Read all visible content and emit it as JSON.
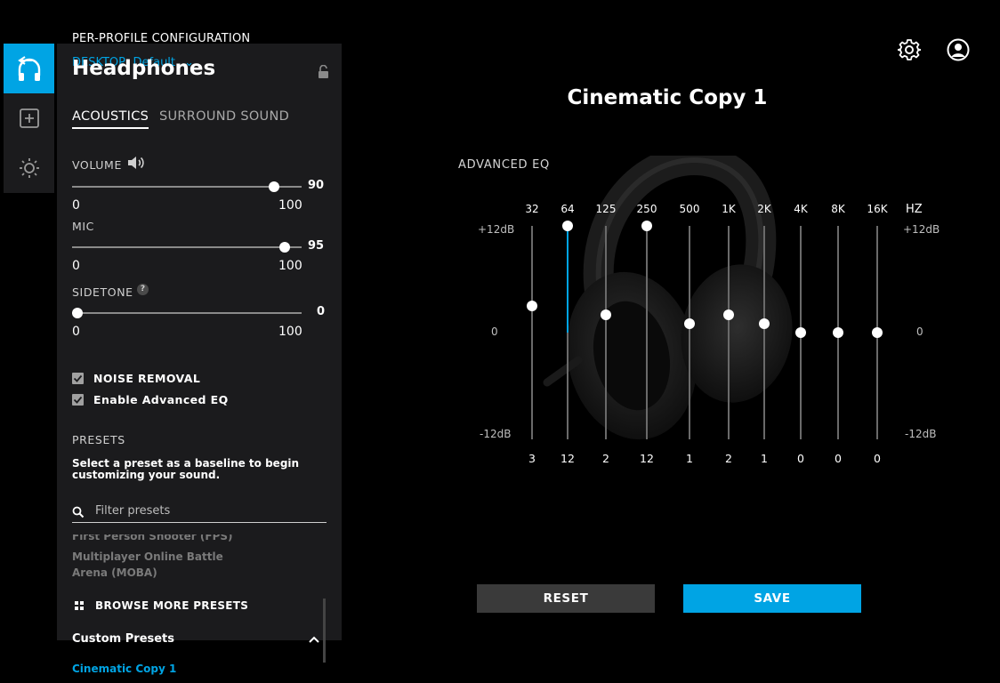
{
  "header": {
    "config_label": "PER-PROFILE CONFIGURATION",
    "profile_selector": "DESKTOP: Default"
  },
  "rail": {
    "items": [
      {
        "icon": "headphones-icon",
        "active": true
      },
      {
        "icon": "add-icon",
        "active": false
      },
      {
        "icon": "lighting-icon",
        "active": false
      }
    ]
  },
  "panel": {
    "title": "Headphones",
    "tabs": {
      "acoustics": "ACOUSTICS",
      "surround": "SURROUND SOUND"
    },
    "volume": {
      "label": "VOLUME",
      "min": "0",
      "max": "100",
      "value": "90"
    },
    "mic": {
      "label": "MIC",
      "min": "0",
      "max": "100",
      "value": "95"
    },
    "sidetone": {
      "label": "SIDETONE",
      "help": "?",
      "min": "0",
      "max": "100",
      "value": "0"
    },
    "noise_removal": {
      "label": "NOISE REMOVAL",
      "checked": true
    },
    "advanced_eq_toggle": {
      "label": "Enable Advanced EQ",
      "checked": true
    },
    "presets": {
      "label": "PRESETS",
      "description": "Select a preset as a baseline to begin customizing your sound.",
      "filter_placeholder": "Filter presets",
      "items": [
        "First Person Shooter (FPS)",
        "Multiplayer Online Battle",
        "Arena (MOBA)"
      ],
      "browse_more": "BROWSE MORE PRESETS",
      "custom_label": "Custom Presets",
      "custom_items": [
        "Cinematic Copy 1"
      ]
    }
  },
  "eq": {
    "profile_title": "Cinematic Copy 1",
    "label": "ADVANCED EQ",
    "unit": "HZ",
    "db_top": "+12dB",
    "db_mid": "0",
    "db_bottom": "-12dB",
    "bands": [
      {
        "freq": "32",
        "gain": "3"
      },
      {
        "freq": "64",
        "gain": "12"
      },
      {
        "freq": "125",
        "gain": "2"
      },
      {
        "freq": "250",
        "gain": "12"
      },
      {
        "freq": "500",
        "gain": "1"
      },
      {
        "freq": "1K",
        "gain": "2"
      },
      {
        "freq": "2K",
        "gain": "1"
      },
      {
        "freq": "4K",
        "gain": "0"
      },
      {
        "freq": "8K",
        "gain": "0"
      },
      {
        "freq": "16K",
        "gain": "0"
      }
    ],
    "reset_label": "RESET",
    "save_label": "SAVE"
  },
  "top_icons": [
    "settings-gear-icon",
    "account-icon"
  ],
  "colors": {
    "accent": "#00a4e4",
    "panel": "#1b1b1d",
    "background": "#000000"
  }
}
